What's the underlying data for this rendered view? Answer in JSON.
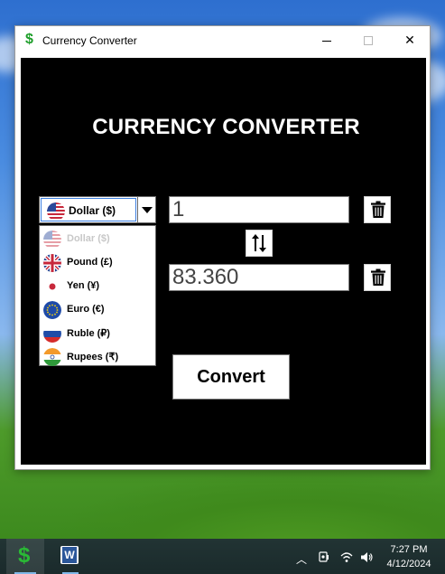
{
  "window": {
    "title": "Currency Converter",
    "icon": "dollar-sign-icon"
  },
  "app": {
    "heading": "CURRENCY CONVERTER",
    "selected_currency": "Dollar ($)",
    "currency_options": [
      {
        "label": "Dollar ($)",
        "flag": "us-flag-icon",
        "disabled": true
      },
      {
        "label": "Pound (£)",
        "flag": "uk-flag-icon",
        "disabled": false
      },
      {
        "label": "Yen (¥)",
        "flag": "japan-flag-icon",
        "disabled": false
      },
      {
        "label": "Euro (€)",
        "flag": "eu-flag-icon",
        "disabled": false
      },
      {
        "label": "Ruble (₽)",
        "flag": "russia-flag-icon",
        "disabled": false
      },
      {
        "label": "Rupees (₹)",
        "flag": "india-flag-icon",
        "disabled": false
      }
    ],
    "input_amount": "1",
    "output_amount": "83.360",
    "convert_label": "Convert"
  },
  "taskbar": {
    "time": "7:27 PM",
    "date": "4/12/2024"
  },
  "colors": {
    "app_background": "#000000",
    "dollar_icon": "#1e9e2a"
  }
}
